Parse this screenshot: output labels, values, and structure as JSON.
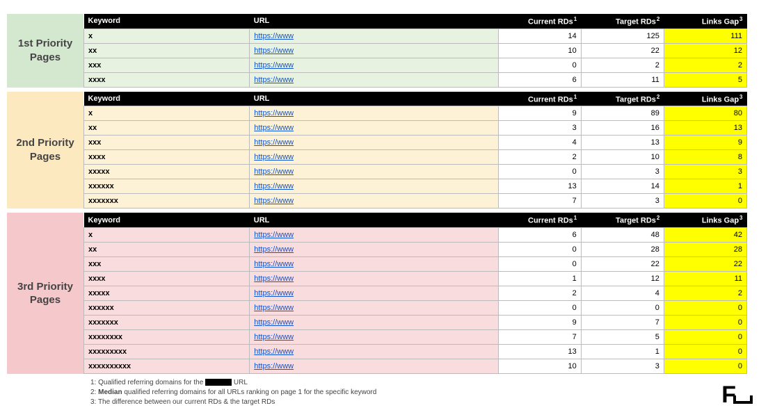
{
  "headers": {
    "keyword": "Keyword",
    "url": "URL",
    "currentRDs": "Current RDs",
    "targetRDs": "Target RDs",
    "linksGap": "Links Gap"
  },
  "sections": [
    {
      "label": "1st Priority Pages",
      "rowClass": "row-1",
      "sideClass": "side-1",
      "rows": [
        {
          "keyword": "x",
          "url": "https://www",
          "current": "14",
          "target": "125",
          "gap": "111"
        },
        {
          "keyword": "xx",
          "url": "https://www",
          "current": "10",
          "target": "22",
          "gap": "12"
        },
        {
          "keyword": "xxx",
          "url": "https://www",
          "current": "0",
          "target": "2",
          "gap": "2"
        },
        {
          "keyword": "xxxx",
          "url": "https://www",
          "current": "6",
          "target": "11",
          "gap": "5"
        }
      ]
    },
    {
      "label": "2nd Priority Pages",
      "rowClass": "row-2",
      "sideClass": "side-2",
      "rows": [
        {
          "keyword": "x",
          "url": "https://www",
          "current": "9",
          "target": "89",
          "gap": "80"
        },
        {
          "keyword": "xx",
          "url": "https://www",
          "current": "3",
          "target": "16",
          "gap": "13"
        },
        {
          "keyword": "xxx",
          "url": "https://www",
          "current": "4",
          "target": "13",
          "gap": "9"
        },
        {
          "keyword": "xxxx",
          "url": "https://www",
          "current": "2",
          "target": "10",
          "gap": "8"
        },
        {
          "keyword": "xxxxx",
          "url": "https://www",
          "current": "0",
          "target": "3",
          "gap": "3"
        },
        {
          "keyword": "xxxxxx",
          "url": "https://www",
          "current": "13",
          "target": "14",
          "gap": "1"
        },
        {
          "keyword": "xxxxxxx",
          "url": "https://www",
          "current": "7",
          "target": "3",
          "gap": "0"
        }
      ]
    },
    {
      "label": "3rd Priority Pages",
      "rowClass": "row-3",
      "sideClass": "side-3",
      "rows": [
        {
          "keyword": "x",
          "url": "https://www",
          "current": "6",
          "target": "48",
          "gap": "42"
        },
        {
          "keyword": "xx",
          "url": "https://www",
          "current": "0",
          "target": "28",
          "gap": "28"
        },
        {
          "keyword": "xxx",
          "url": "https://www",
          "current": "0",
          "target": "22",
          "gap": "22"
        },
        {
          "keyword": "xxxx",
          "url": "https://www",
          "current": "1",
          "target": "12",
          "gap": "11"
        },
        {
          "keyword": "xxxxx",
          "url": "https://www",
          "current": "2",
          "target": "4",
          "gap": "2"
        },
        {
          "keyword": "xxxxxx",
          "url": "https://www",
          "current": "0",
          "target": "0",
          "gap": "0"
        },
        {
          "keyword": "xxxxxxx",
          "url": "https://www",
          "current": "9",
          "target": "7",
          "gap": "0"
        },
        {
          "keyword": "xxxxxxxx",
          "url": "https://www",
          "current": "7",
          "target": "5",
          "gap": "0"
        },
        {
          "keyword": "xxxxxxxxx",
          "url": "https://www",
          "current": "13",
          "target": "1",
          "gap": "0"
        },
        {
          "keyword": "xxxxxxxxxx",
          "url": "https://www",
          "current": "10",
          "target": "3",
          "gap": "0"
        }
      ]
    }
  ],
  "footnotes": {
    "f1a": "1: Qualified referring domains for the ",
    "f1b": " URL",
    "f2": "2: Median qualified referring domains for all URLs ranking on page 1 for the specific keyword",
    "f2_bold": "Median",
    "f2_pre": "2: ",
    "f2_post": " qualified referring domains for all URLs ranking on page 1 for the specific keyword",
    "f3": "3: The difference between our current RDs & the target RDs"
  },
  "logo": "F"
}
